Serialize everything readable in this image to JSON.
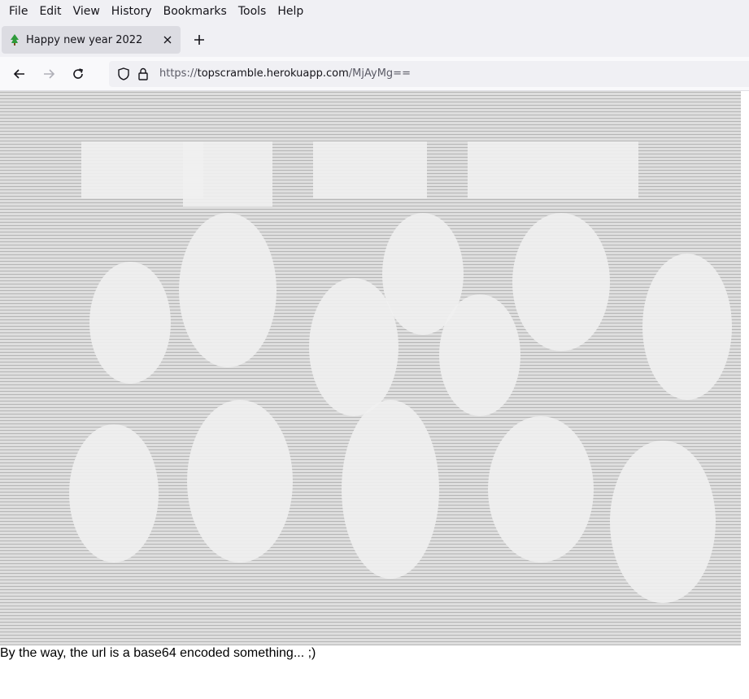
{
  "menu": {
    "items": [
      "File",
      "Edit",
      "View",
      "History",
      "Bookmarks",
      "Tools",
      "Help"
    ]
  },
  "tab": {
    "title": "Happy new year 2022",
    "favicon": "tree-icon"
  },
  "navigation": {
    "back": "back-arrow-icon",
    "forward": "forward-arrow-icon",
    "reload": "reload-icon"
  },
  "urlbar": {
    "scheme": "https://",
    "host": "topscramble.herokuapp.com",
    "path": "/MjAyMg=="
  },
  "page": {
    "caption": "By the way, the url is a base64 encoded something... ;)"
  },
  "colors": {
    "chrome": "#f0f0f4",
    "tab_active": "#dcdce2",
    "favicon_green": "#2e9a3a"
  }
}
